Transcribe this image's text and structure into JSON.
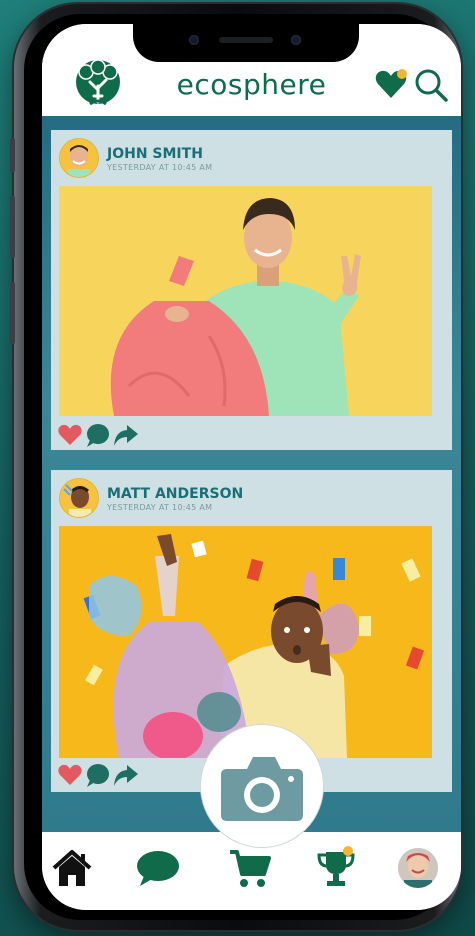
{
  "app": {
    "brand": "ecosphere"
  },
  "colors": {
    "brand_green": "#0f6b4a",
    "like_red": "#e25a5f",
    "action_green": "#1f6e63",
    "author_teal": "#1a6f77",
    "badge_gold": "#f2b632",
    "camera_gray": "#6e9aa1"
  },
  "header": {
    "logo_icon": "tree-logo-icon",
    "favorites_icon": "heart-icon",
    "search_icon": "search-icon"
  },
  "posts": [
    {
      "author": "JOHN SMITH",
      "time": "YESTERDAY AT 10:45 AM",
      "actions": [
        "like-icon",
        "comment-icon",
        "share-icon"
      ]
    },
    {
      "author": "MATT ANDERSON",
      "time": "YESTERDAY AT 10:45 AM",
      "actions": [
        "like-icon",
        "comment-icon",
        "share-icon"
      ]
    }
  ],
  "fab": {
    "icon": "camera-icon"
  },
  "nav": {
    "items": [
      "home-icon",
      "chat-icon",
      "cart-icon",
      "trophy-icon",
      "profile-avatar"
    ]
  }
}
